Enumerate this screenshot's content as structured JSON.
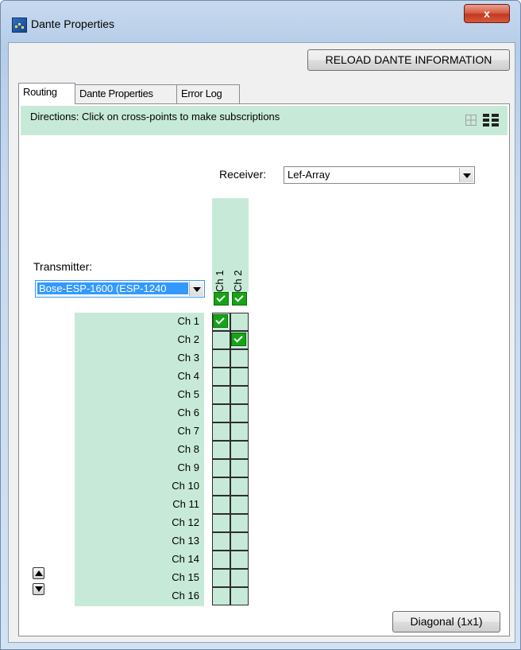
{
  "window": {
    "title": "Dante Properties",
    "close_label": "x"
  },
  "toolbar": {
    "reload_label": "RELOAD DANTE INFORMATION"
  },
  "tabs": [
    {
      "label": "Routing",
      "active": true
    },
    {
      "label": "Dante Properties",
      "active": false
    },
    {
      "label": "Error Log",
      "active": false
    }
  ],
  "routing": {
    "directions": "Directions: Click on cross-points to make subscriptions",
    "receiver_label": "Receiver:",
    "receiver_value": "Lef-Array",
    "transmitter_label": "Transmitter:",
    "transmitter_value": "Bose-ESP-1600 (ESP-1240",
    "columns": [
      "Ch 1",
      "Ch 2"
    ],
    "column_header_checked": [
      true,
      true
    ],
    "rows": [
      "Ch 1",
      "Ch 2",
      "Ch 3",
      "Ch 4",
      "Ch 5",
      "Ch 6",
      "Ch 7",
      "Ch 8",
      "Ch 9",
      "Ch 10",
      "Ch 11",
      "Ch 12",
      "Ch 13",
      "Ch 14",
      "Ch 15",
      "Ch 16"
    ],
    "subscriptions": [
      [
        0,
        0
      ],
      [
        1,
        1
      ]
    ],
    "diagonal_label": "Diagonal (1x1)"
  },
  "icons": {
    "grid_view": "grid-view-icon",
    "list_view": "list-view-icon",
    "scroll_up": "scroll-up-icon",
    "scroll_down": "scroll-down-icon"
  },
  "colors": {
    "matrix_green": "#c7ead8",
    "check_green": "#16a416",
    "selection_blue": "#3399ff"
  }
}
